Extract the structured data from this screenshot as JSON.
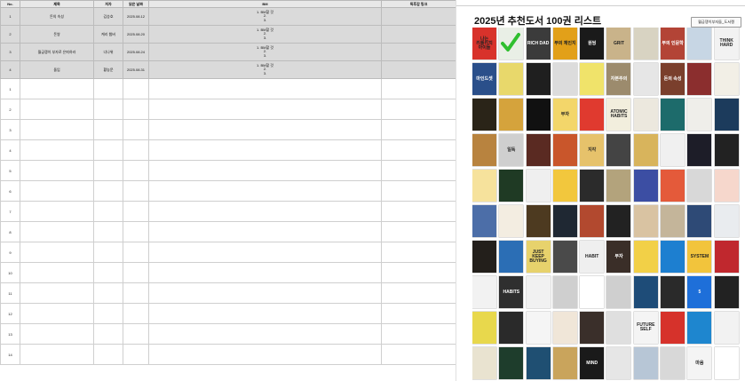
{
  "sheet": {
    "headers": [
      "No.",
      "제목",
      "저자",
      "읽은 날짜",
      "BM",
      "독후감 링크"
    ],
    "rows": [
      {
        "no": "1",
        "title": "돈의 속성",
        "author": "김승호",
        "date": "2025.08.12",
        "bm": [
          "1. BM할 것",
          "2.",
          "3."
        ],
        "link": ""
      },
      {
        "no": "2",
        "title": "돈쌍",
        "author": "케리 챔버",
        "date": "2025.08.20",
        "bm": [
          "1. BM할 것",
          "2.",
          "3."
        ],
        "link": ""
      },
      {
        "no": "3",
        "title": "월급쟁이 부자로 은퇴하라",
        "author": "너나위",
        "date": "2025.08.24",
        "bm": [
          "1. BM할 것",
          "2.",
          "3."
        ],
        "link": ""
      },
      {
        "no": "4",
        "title": "돌입",
        "author": "황농문",
        "date": "2025.08.31",
        "bm": [
          "1. BM할 것",
          "2.",
          "3."
        ],
        "link": ""
      }
    ],
    "empty_row_numbers": [
      "1",
      "2",
      "3",
      "4",
      "5",
      "6",
      "7",
      "8",
      "9",
      "10",
      "11",
      "12",
      "13",
      "14"
    ]
  },
  "panel": {
    "title": "2025년 추천도서 100권 리스트",
    "source_button": "월급쟁이부자들_도서랭"
  },
  "books": [
    {
      "text": "나는 리틀리치 아이들",
      "color": "#d8322b"
    },
    {
      "text": "",
      "color": "#e9efe6",
      "checked": true
    },
    {
      "text": "RICH DAD",
      "color": "#3b3b3b"
    },
    {
      "text": "부의 체인지",
      "color": "#e2a019"
    },
    {
      "text": "원씽",
      "color": "#1a1a1a"
    },
    {
      "text": "GRIT",
      "color": "#c9b38a"
    },
    {
      "text": "",
      "color": "#d8d3c2"
    },
    {
      "text": "부의 인문학",
      "color": "#b34436"
    },
    {
      "text": "",
      "color": "#c7d6e4"
    },
    {
      "text": "THINK HARD",
      "color": "#f2f2f2"
    },
    {
      "text": "마인드셋",
      "color": "#2a4f8a"
    },
    {
      "text": "",
      "color": "#e8d86b"
    },
    {
      "text": "",
      "color": "#1f1f1f"
    },
    {
      "text": "",
      "color": "#dcdcdc"
    },
    {
      "text": "",
      "color": "#f0e36a"
    },
    {
      "text": "자본주의",
      "color": "#9c8b6d"
    },
    {
      "text": "",
      "color": "#e6e6e6"
    },
    {
      "text": "돈의 속성",
      "color": "#7a3f2c"
    },
    {
      "text": "",
      "color": "#8b2e2e"
    },
    {
      "text": "",
      "color": "#f2efe6"
    },
    {
      "text": "",
      "color": "#2a2418"
    },
    {
      "text": "",
      "color": "#d5a33c"
    },
    {
      "text": "",
      "color": "#111111"
    },
    {
      "text": "부자",
      "color": "#f3d66a"
    },
    {
      "text": "",
      "color": "#e03a2f"
    },
    {
      "text": "ATOMIC HABITS",
      "color": "#f2eedd"
    },
    {
      "text": "",
      "color": "#ece8de"
    },
    {
      "text": "",
      "color": "#1d6b6b"
    },
    {
      "text": "",
      "color": "#efeeea"
    },
    {
      "text": "",
      "color": "#1c3b5c"
    },
    {
      "text": "",
      "color": "#b8833f"
    },
    {
      "text": "일독",
      "color": "#cfcfcf"
    },
    {
      "text": "",
      "color": "#5a2a22"
    },
    {
      "text": "",
      "color": "#c9562b"
    },
    {
      "text": "지각",
      "color": "#e6c26b"
    },
    {
      "text": "",
      "color": "#444444"
    },
    {
      "text": "",
      "color": "#d8b45c"
    },
    {
      "text": "",
      "color": "#f0f0f0"
    },
    {
      "text": "",
      "color": "#1d1d28"
    },
    {
      "text": "",
      "color": "#222222"
    },
    {
      "text": "",
      "color": "#f6e29c"
    },
    {
      "text": "",
      "color": "#1f3a24"
    },
    {
      "text": "",
      "color": "#efefef"
    },
    {
      "text": "",
      "color": "#f2c73d"
    },
    {
      "text": "",
      "color": "#2b2b2b"
    },
    {
      "text": "",
      "color": "#b3a37c"
    },
    {
      "text": "",
      "color": "#3c4ea3"
    },
    {
      "text": "",
      "color": "#e45a3a"
    },
    {
      "text": "",
      "color": "#d8d8d8"
    },
    {
      "text": "",
      "color": "#f6d7cc"
    },
    {
      "text": "",
      "color": "#4c6ea8"
    },
    {
      "text": "",
      "color": "#f3ede1"
    },
    {
      "text": "",
      "color": "#4d3a20"
    },
    {
      "text": "",
      "color": "#1f2833"
    },
    {
      "text": "",
      "color": "#b2492f"
    },
    {
      "text": "",
      "color": "#222222"
    },
    {
      "text": "",
      "color": "#d9c3a2"
    },
    {
      "text": "",
      "color": "#c4b59a"
    },
    {
      "text": "",
      "color": "#2e4a76"
    },
    {
      "text": "",
      "color": "#e9ecef"
    },
    {
      "text": "",
      "color": "#231f1b"
    },
    {
      "text": "",
      "color": "#2b6eb5"
    },
    {
      "text": "JUST KEEP BUYING",
      "color": "#e7d26c"
    },
    {
      "text": "",
      "color": "#4a4a4a"
    },
    {
      "text": "HABIT",
      "color": "#efefef"
    },
    {
      "text": "부자",
      "color": "#3a2e28"
    },
    {
      "text": "",
      "color": "#f2d047"
    },
    {
      "text": "",
      "color": "#1d7fd0"
    },
    {
      "text": "SYSTEM",
      "color": "#f2c43c"
    },
    {
      "text": "",
      "color": "#c0282e"
    },
    {
      "text": "",
      "color": "#f2f2f2"
    },
    {
      "text": "HABITS",
      "color": "#2f2f2f"
    },
    {
      "text": "",
      "color": "#f1f1f1"
    },
    {
      "text": "",
      "color": "#cfcfcf"
    },
    {
      "text": "",
      "color": "#ffffff"
    },
    {
      "text": "",
      "color": "#cfcfcf"
    },
    {
      "text": "",
      "color": "#1e4c78"
    },
    {
      "text": "",
      "color": "#2a2a2a"
    },
    {
      "text": "5",
      "color": "#1e6fd9"
    },
    {
      "text": "",
      "color": "#222222"
    },
    {
      "text": "",
      "color": "#e8d84c"
    },
    {
      "text": "",
      "color": "#2a2a2a"
    },
    {
      "text": "",
      "color": "#f5f5f5"
    },
    {
      "text": "",
      "color": "#f0e6d8"
    },
    {
      "text": "",
      "color": "#3a2f2a"
    },
    {
      "text": "",
      "color": "#dfdfdf"
    },
    {
      "text": "FUTURE SELF",
      "color": "#f4f4f4"
    },
    {
      "text": "",
      "color": "#d6322b"
    },
    {
      "text": "",
      "color": "#1e86cf"
    },
    {
      "text": "",
      "color": "#f2f2f2"
    },
    {
      "text": "",
      "color": "#e9e3d0"
    },
    {
      "text": "",
      "color": "#1e3d2c"
    },
    {
      "text": "",
      "color": "#1f4f72"
    },
    {
      "text": "",
      "color": "#c9a45c"
    },
    {
      "text": "MIND",
      "color": "#1a1a1a"
    },
    {
      "text": "",
      "color": "#e6e6e6"
    },
    {
      "text": "",
      "color": "#b7c6d6"
    },
    {
      "text": "",
      "color": "#d8d8d8"
    },
    {
      "text": "마음",
      "color": "#f4f4f4"
    },
    {
      "text": "",
      "color": "#ffffff"
    }
  ]
}
